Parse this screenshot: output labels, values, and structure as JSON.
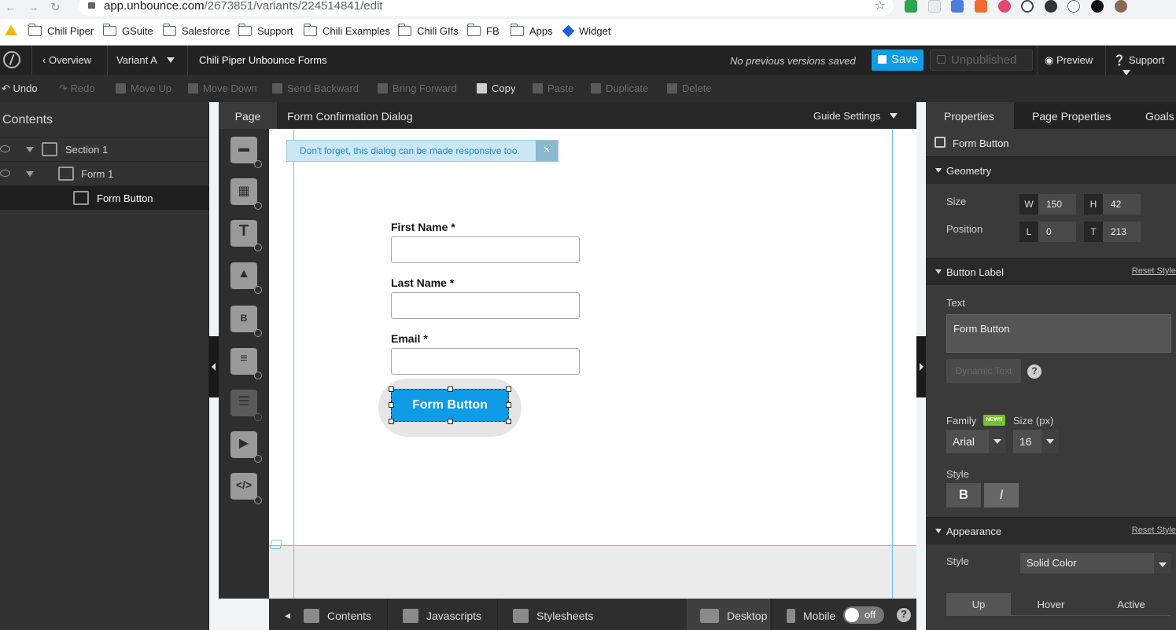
{
  "browser": {
    "url_host": "app.unbounce.com",
    "url_path": "/2673851/variants/224514841/edit",
    "bookmarks": [
      "Chili Piper",
      "GSuite",
      "Salesforce",
      "Support",
      "Chili Examples",
      "Chili GIfs",
      "FB",
      "Apps",
      "Widget"
    ]
  },
  "header": {
    "overview": "Overview",
    "variant": "Variant A",
    "page_title": "Chili Piper Unbounce Forms",
    "versions_status": "No previous versions saved",
    "save": "Save",
    "unpublished": "Unpublished",
    "preview": "Preview",
    "support": "Support"
  },
  "toolbar": {
    "undo": "Undo",
    "redo": "Redo",
    "move_up": "Move Up",
    "move_down": "Move Down",
    "send_backward": "Send Backward",
    "bring_forward": "Bring Forward",
    "copy": "Copy",
    "paste": "Paste",
    "duplicate": "Duplicate",
    "delete": "Delete"
  },
  "contents": {
    "title": "Contents",
    "tree": [
      "Section 1",
      "Form 1",
      "Form Button"
    ]
  },
  "canvas_tabs": {
    "page": "Page",
    "dialog": "Form Confirmation Dialog",
    "guide_settings": "Guide Settings"
  },
  "canvas": {
    "tooltip": "Don't forget, this dialog can be made responsive too.",
    "tooltip_close": "×",
    "fields": [
      "First Name *",
      "Last Name *",
      "Email *"
    ],
    "button": "Form Button"
  },
  "bottom_bar": {
    "contents": "Contents",
    "javascripts": "Javascripts",
    "stylesheets": "Stylesheets",
    "desktop": "Desktop",
    "mobile": "Mobile",
    "toggle": "off",
    "help": "?"
  },
  "properties": {
    "tabs": [
      "Properties",
      "Page Properties",
      "Goals"
    ],
    "element": "Form Button",
    "geometry": {
      "title": "Geometry",
      "size_label": "Size",
      "position_label": "Position",
      "w_key": "W",
      "w": "150",
      "h_key": "H",
      "h": "42",
      "l_key": "L",
      "l": "0",
      "t_key": "T",
      "t": "213"
    },
    "button_label": {
      "title": "Button Label",
      "reset": "Reset Style",
      "text_label": "Text",
      "text": "Form Button",
      "dynamic_text": "Dynamic Text",
      "help": "?",
      "family_label": "Family",
      "new_badge": "NEW!!",
      "size_label": "Size (px)",
      "family": "Arial",
      "size": "16",
      "style_label": "Style",
      "bold": "B",
      "italic": "I"
    },
    "appearance": {
      "title": "Appearance",
      "reset": "Reset Style",
      "style_label": "Style",
      "style": "Solid Color",
      "states": [
        "Up",
        "Hover",
        "Active"
      ]
    }
  },
  "colors": {
    "accent": "#0e9ce7",
    "dark_bg": "#222222",
    "panel_bg": "#3a3a3a"
  }
}
